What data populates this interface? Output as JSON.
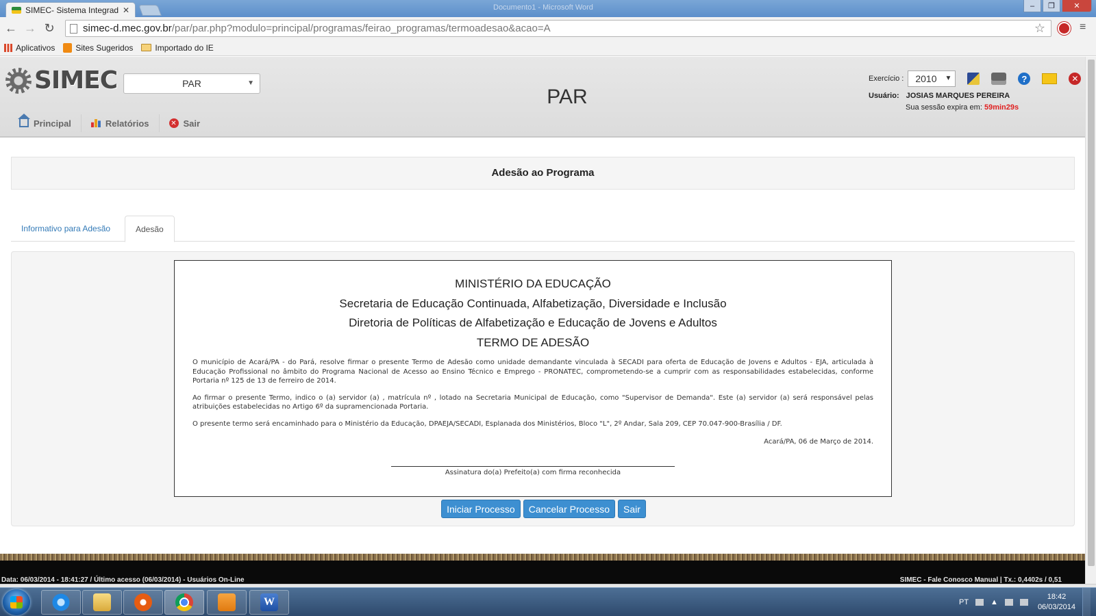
{
  "browser": {
    "tab_title": "SIMEC- Sistema Integrado",
    "tab_close": "✕",
    "window_caption": "Documento1 - Microsoft Word",
    "url_domain": "simec-d.mec.gov.br",
    "url_path": "/par/par.php?modulo=principal/programas/feirao_programas/termoadesao&acao=A",
    "bookmarks": [
      "Aplicativos",
      "Sites Sugeridos",
      "Importado do IE"
    ]
  },
  "header": {
    "logo_text": "SIMEC",
    "module_select": "PAR",
    "page_title": "PAR",
    "exercise_label": "Exercício :",
    "exercise_year": "2010",
    "user_label": "Usuário:",
    "user_name": "JOSIAS MARQUES PEREIRA",
    "session_label": "Sua sessão expira em:",
    "session_time": "59min29s",
    "menu": [
      {
        "label": "Principal",
        "icon": "home-icon"
      },
      {
        "label": "Relatórios",
        "icon": "report-icon"
      },
      {
        "label": "Sair",
        "icon": "exit-icon"
      }
    ]
  },
  "content": {
    "title": "Adesão ao Programa",
    "tabs": [
      {
        "label": "Informativo para Adesão",
        "active": false
      },
      {
        "label": "Adesão",
        "active": true
      }
    ],
    "term": {
      "heading_1": "MINISTÉRIO DA EDUCAÇÃO",
      "heading_2": "Secretaria de Educação Continuada, Alfabetização, Diversidade e Inclusão",
      "heading_3": "Diretoria de Políticas de Alfabetização e Educação de Jovens e Adultos",
      "heading_4": "TERMO DE ADESÃO",
      "paragraph_1": "O município de Acará/PA - do Pará, resolve firmar o presente Termo de Adesão como unidade demandante vinculada à SECADI para oferta de Educação de Jovens e Adultos - EJA, articulada à Educação Profissional no âmbito do Programa Nacional de Acesso ao Ensino Técnico e Emprego - PRONATEC, comprometendo-se a cumprir com as responsabilidades estabelecidas, conforme Portaria nº 125 de 13 de ferreiro de 2014.",
      "paragraph_2": "Ao firmar o presente Termo, indico o (a) servidor (a) , matrícula nº , lotado na Secretaria Municipal de Educação, como \"Supervisor de Demanda\". Este (a) servidor (a) será responsável pelas atribuições estabelecidas no Artigo 6º da supramencionada Portaria.",
      "paragraph_3": "O presente termo será encaminhado para o Ministério da Educação, DPAEJA/SECADI, Esplanada dos Ministérios, Bloco \"L\", 2º Andar, Sala 209, CEP 70.047-900-Brasília / DF.",
      "date": "Acará/PA, 06 de Março de 2014.",
      "signature_caption": "Assinatura do(a) Prefeito(a) com firma reconhecida"
    },
    "buttons": {
      "start": "Iniciar Processo",
      "cancel": "Cancelar Processo",
      "exit": "Sair"
    }
  },
  "footer": {
    "left": "Data: 06/03/2014 - 18:41:27 / Último acesso (06/03/2014) - Usuários On-Line",
    "right": "SIMEC - Fale Conosco Manual | Tx.: 0,4402s / 0,51"
  },
  "taskbar": {
    "language": "PT",
    "time": "18:42",
    "date": "06/03/2014"
  },
  "colors": {
    "primary_button": "#3d8fd1",
    "link": "#337ab7",
    "session_time": "#e02020"
  }
}
